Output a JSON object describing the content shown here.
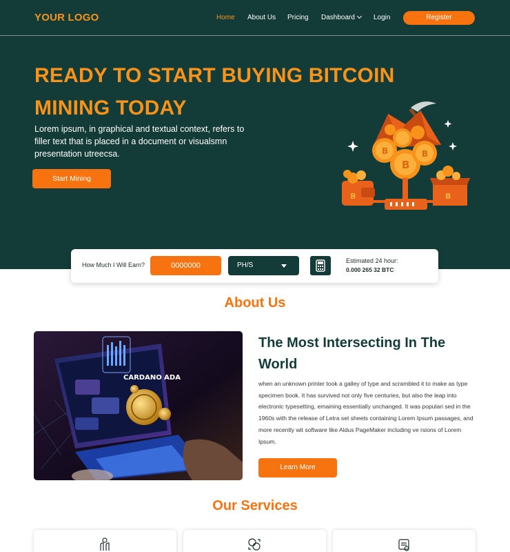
{
  "nav": {
    "logo": "YOUR LOGO",
    "links": [
      "Home",
      "About Us",
      "Pricing",
      "Dashboard",
      "Login"
    ],
    "register": "Register"
  },
  "hero": {
    "title": "READY TO START BUYING BITCOIN MINING TODAY",
    "text": "Lorem ipsum, in graphical and textual context, refers to filler text that is placed in a document or visualsmn presentation utreecsa.",
    "cta": "Start Mining"
  },
  "calculator": {
    "label": "How Much I Will Earn?",
    "input_value": "0000000",
    "unit": "PH/S",
    "estimate_label": "Estimated 24 hour:",
    "estimate_value": "0.000 265 32 BTC"
  },
  "about": {
    "section_title": "About Us",
    "heading": "The Most Intersecting In The World",
    "body": "when an unknown printer took a galley of type and scrambled it to make as type specimen book. It has survived not only five centuries, but also the leap into electronic typesetting, emaining essentially unchanged. It was populari sed in the 1960s with the release of Letra set sheets containing Lorem Ipsum passages, and more recently wit software like Aldus PageMaker including ve rsions of Lorem Ipsum.",
    "cta": "Learn More",
    "image_text": "CARDANO ADA"
  },
  "services": {
    "section_title": "Our Services",
    "icons": [
      "mining-hand-icon",
      "exchange-coin-icon",
      "wallet-device-icon"
    ]
  },
  "colors": {
    "primary_dark": "#133c39",
    "accent": "#f7730f",
    "title_orange": "#f7931a"
  }
}
